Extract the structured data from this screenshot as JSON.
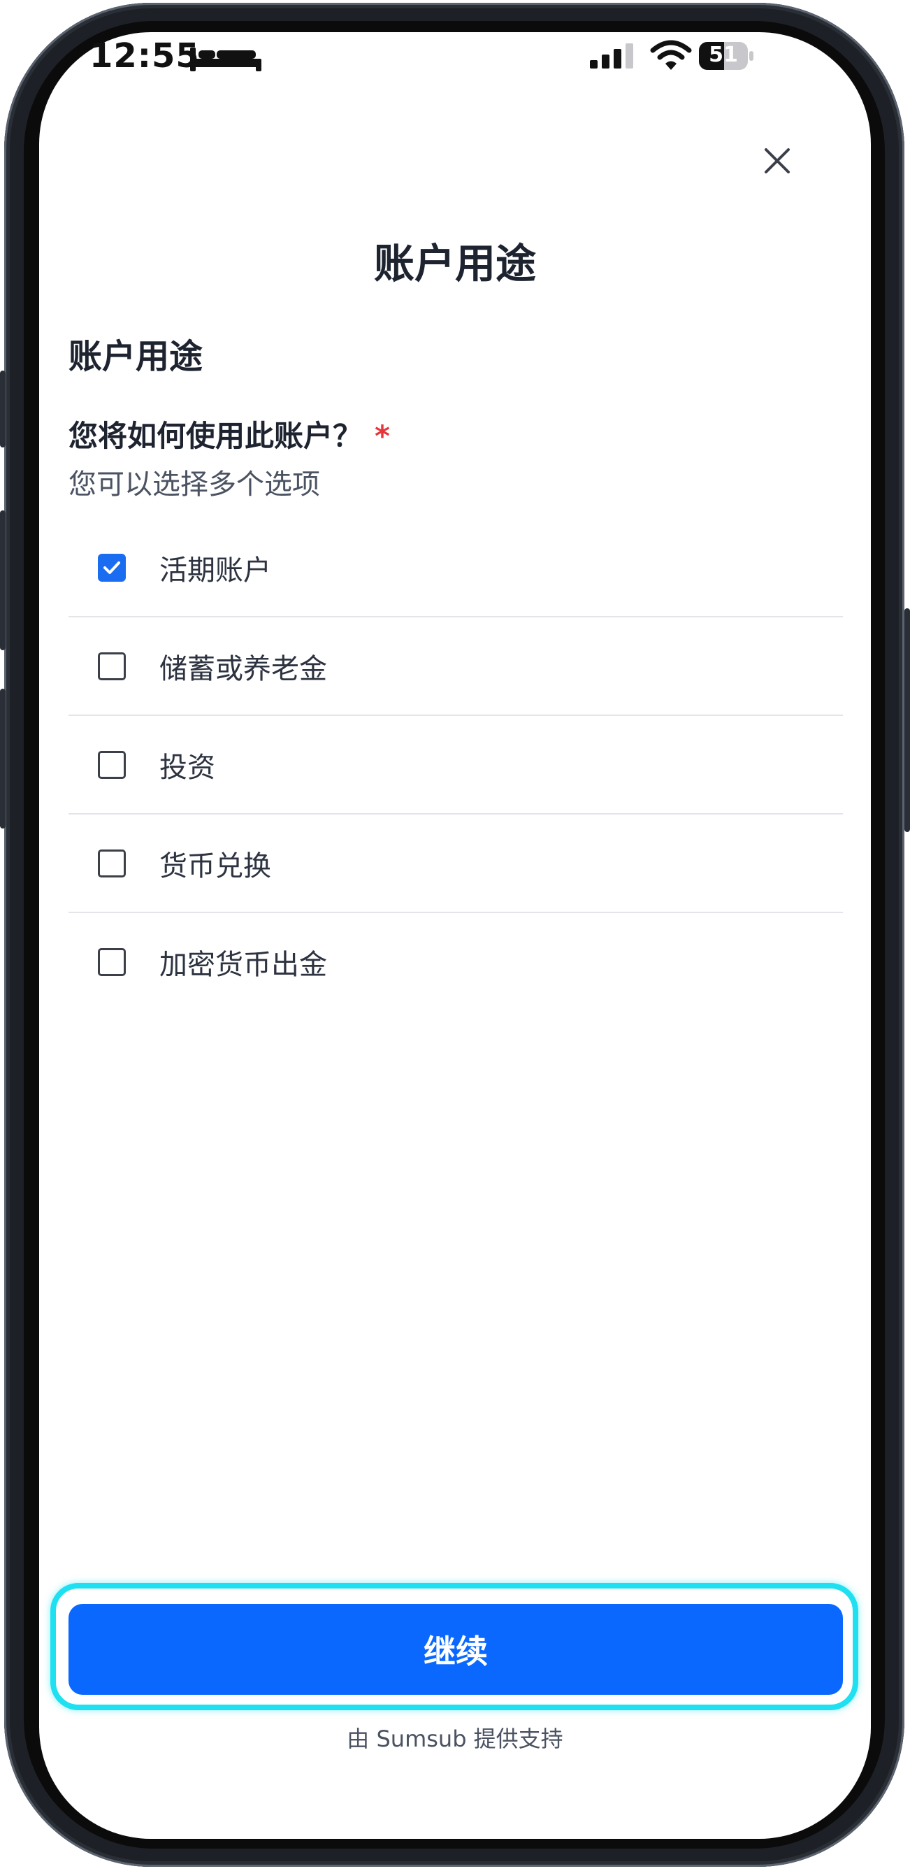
{
  "status_bar": {
    "time": "12:55",
    "battery": "51",
    "battery_fraction": 0.51
  },
  "header": {
    "title": "账户用途"
  },
  "section": {
    "title": "账户用途"
  },
  "question": {
    "text": "您将如何使用此账户？",
    "required_mark": "*",
    "hint": "您可以选择多个选项"
  },
  "options": [
    {
      "label": "活期账户",
      "checked": true
    },
    {
      "label": "储蓄或养老金",
      "checked": false
    },
    {
      "label": "投资",
      "checked": false
    },
    {
      "label": "货币兑换",
      "checked": false
    },
    {
      "label": "加密货币出金",
      "checked": false
    }
  ],
  "actions": {
    "continue_label": "继续"
  },
  "footer": {
    "powered_by": "由 Sumsub 提供支持"
  },
  "colors": {
    "accent": "#0a68ff",
    "checkbox_checked": "#1a6df0",
    "required": "#e5363b",
    "highlight": "#1ee0f0"
  }
}
